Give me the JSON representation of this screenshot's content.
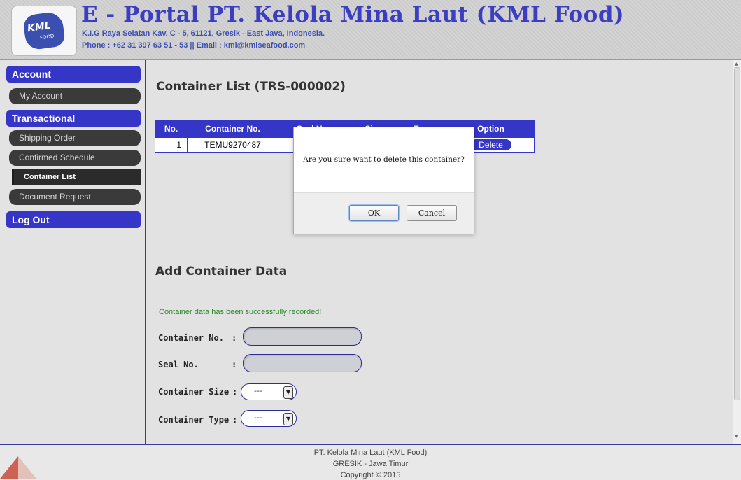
{
  "header": {
    "logo_text": "KML",
    "logo_sub": "FOOD",
    "title": "E - Portal PT. Kelola Mina Laut (KML Food)",
    "address": "K.I.G Raya Selatan Kav. C - 5, 61121, Gresik - East Java, Indonesia.",
    "contact": "Phone : +62 31 397 63 51 - 53  ||  Email : kml@kmlseafood.com"
  },
  "sidebar": {
    "account_heading": "Account",
    "my_account": "My Account",
    "transactional_heading": "Transactional",
    "shipping_order": "Shipping Order",
    "confirmed_schedule": "Confirmed Schedule",
    "container_list": "Container List",
    "document_request": "Document Request",
    "logout": "Log Out"
  },
  "main": {
    "page_title": "Container List (TRS-000002)",
    "table": {
      "headers": [
        "No.",
        "Container No.",
        "Seal No.",
        "Size",
        "Type",
        "Option"
      ],
      "rows": [
        {
          "no": "1",
          "container_no": "TEMU9270487",
          "option": "Delete"
        }
      ]
    },
    "add_title": "Add Container Data",
    "success_msg": "Container data has been successfully recorded!",
    "form": {
      "container_no_label": "Container No.",
      "seal_no_label": "Seal No.",
      "container_size_label": "Container Size",
      "container_type_label": "Container Type",
      "colon": ":",
      "size_value": "---",
      "type_value": "---"
    }
  },
  "dialog": {
    "message": "Are you sure want to delete this container?",
    "ok": "OK",
    "cancel": "Cancel"
  },
  "footer": {
    "company": "PT. Kelola Mina Laut (KML Food)",
    "location": "GRESIK - Jawa Timur",
    "copyright": "Copyright © 2015"
  },
  "colors": {
    "brand_blue": "#3535c8",
    "success_green": "#2a8a2a"
  }
}
